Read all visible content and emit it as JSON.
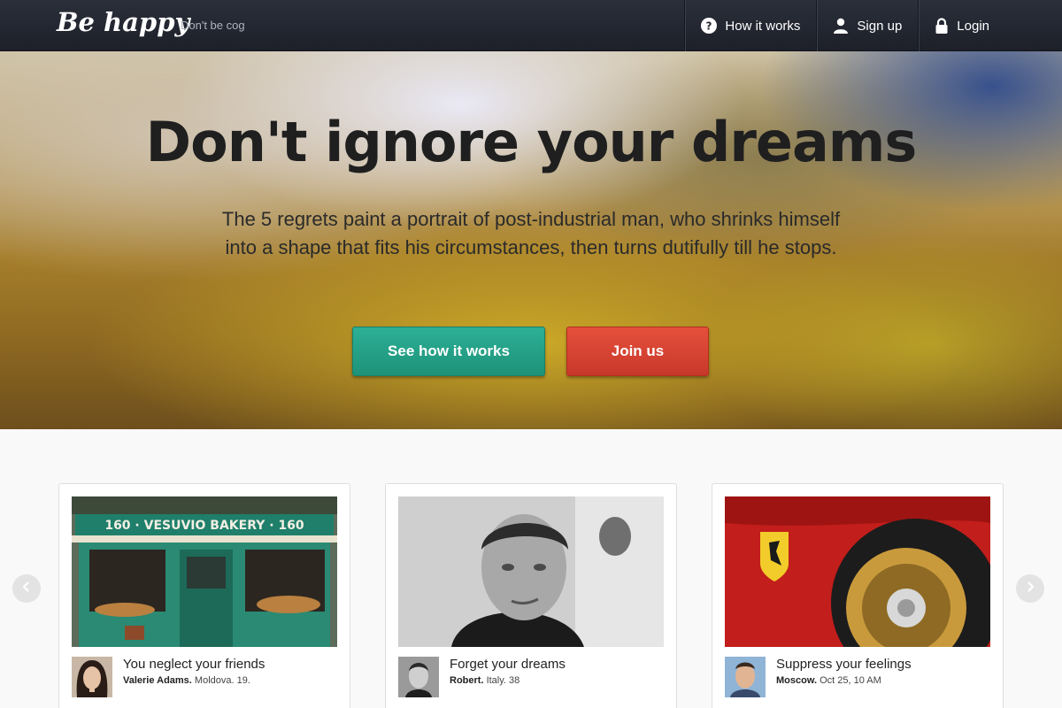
{
  "navbar": {
    "brand": "Be happy",
    "tagline": "Don't be cog",
    "items": [
      {
        "label": "How it works",
        "icon": "question-circle-icon"
      },
      {
        "label": "Sign up",
        "icon": "user-icon"
      },
      {
        "label": "Login",
        "icon": "lock-icon"
      }
    ]
  },
  "hero": {
    "title": "Don't ignore your dreams",
    "subtitle": "The 5 regrets paint a portrait of post-industrial man, who shrinks himself into a shape that fits his circumstances, then turns dutifully till he stops.",
    "primary_button": "See how it works",
    "secondary_button": "Join us"
  },
  "cards": [
    {
      "title": "You neglect your friends",
      "author": "Valerie Adams.",
      "details": "Moldova. 19.",
      "sign_text": "160 · VESUVIO BAKERY · 160"
    },
    {
      "title": "Forget your dreams",
      "author": "Robert.",
      "details": "Italy. 38"
    },
    {
      "title": "Suppress your feelings",
      "author": "Moscow.",
      "details": "Oct 25, 10 AM"
    }
  ],
  "colors": {
    "navbar": "#1d2029",
    "primary": "#1e9279",
    "danger": "#c8382a",
    "page_bg": "#f9f9f9"
  }
}
